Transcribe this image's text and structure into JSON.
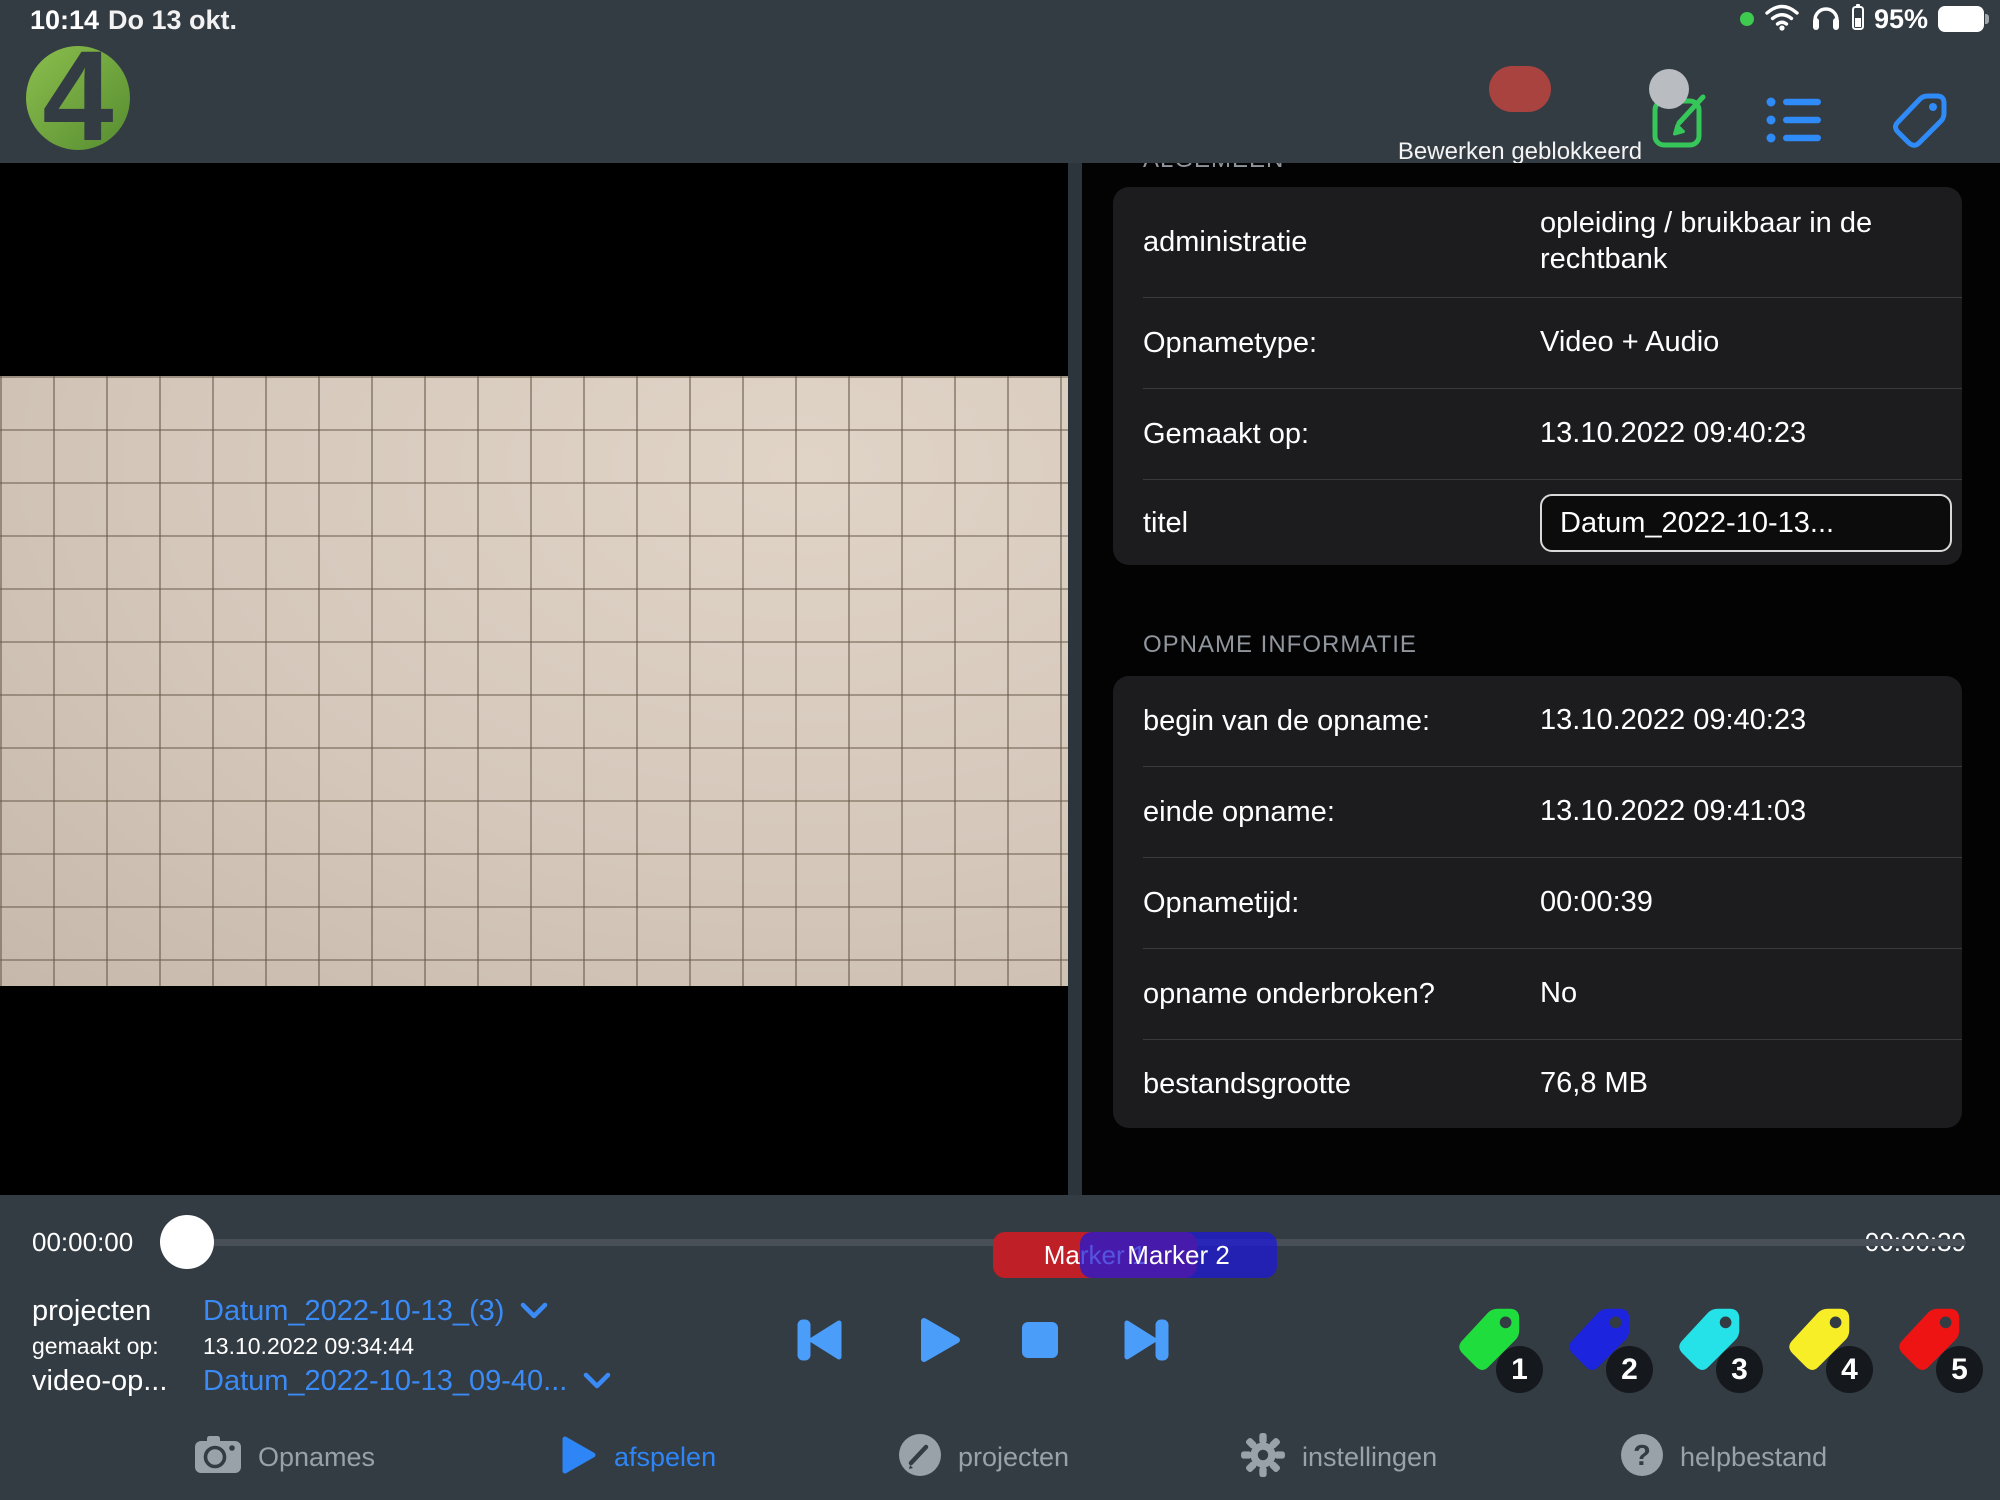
{
  "status_bar": {
    "time": "10:14",
    "date": "Do 13 okt.",
    "battery_percent": "95%"
  },
  "toolbar": {
    "edit_lock_label": "Bewerken geblokkeerd"
  },
  "logo": {
    "glyph": "4"
  },
  "general": {
    "clipped_header": "ALGEMEEN",
    "rows": [
      {
        "label": "administratie",
        "value": "opleiding / bruikbaar in de rechtbank"
      },
      {
        "label": "Opnametype:",
        "value": "Video + Audio"
      },
      {
        "label": "Gemaakt op:",
        "value": "13.10.2022 09:40:23"
      }
    ],
    "title_row": {
      "label": "titel",
      "value": "Datum_2022-10-13..."
    }
  },
  "recording_info": {
    "header": "OPNAME INFORMATIE",
    "rows": [
      {
        "label": "begin van de opname:",
        "value": "13.10.2022 09:40:23"
      },
      {
        "label": "einde opname:",
        "value": "13.10.2022 09:41:03"
      },
      {
        "label": "Opnametijd:",
        "value": "00:00:39"
      },
      {
        "label": "opname onderbroken?",
        "value": "No"
      },
      {
        "label": "bestandsgrootte",
        "value": "76,8 MB"
      }
    ]
  },
  "timeline": {
    "current": "00:00:00",
    "total": "00:00:39",
    "markers": [
      {
        "label": "Marker 1",
        "color": "#bf2028"
      },
      {
        "label": "Marker 2",
        "color": "rgba(30,25,215,0.75)"
      }
    ]
  },
  "project": {
    "rows": [
      {
        "label": "projecten",
        "value": "Datum_2022-10-13_(3)"
      },
      {
        "label": "gemaakt op:",
        "value": "13.10.2022 09:34:44"
      },
      {
        "label": "video-op...",
        "value": "Datum_2022-10-13_09-40..."
      }
    ]
  },
  "tags": [
    {
      "number": "1",
      "color": "#20dd3e"
    },
    {
      "number": "2",
      "color": "#1c24dd"
    },
    {
      "number": "3",
      "color": "#25e2e8"
    },
    {
      "number": "4",
      "color": "#f7ee28"
    },
    {
      "number": "5",
      "color": "#ef1414"
    }
  ],
  "nav": {
    "items": [
      {
        "label": "Opnames"
      },
      {
        "label": "afspelen"
      },
      {
        "label": "projecten"
      },
      {
        "label": "instellingen"
      },
      {
        "label": "helpbestand",
        "glyph": "?"
      }
    ]
  },
  "colors": {
    "accent_blue": "#3b8bf7",
    "accent_green": "#35c759",
    "toggle_red": "#a94340",
    "panel_card": "#1c1c1e"
  }
}
